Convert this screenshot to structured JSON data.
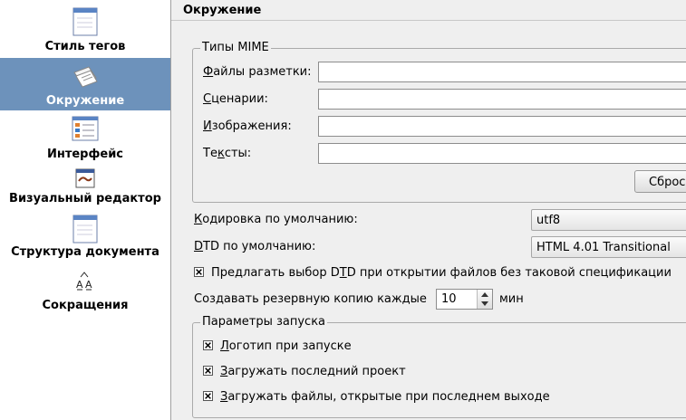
{
  "sidebar": {
    "items": [
      {
        "label": "Стиль тегов",
        "icon": "tag-style-icon"
      },
      {
        "label": "Окружение",
        "icon": "environment-icon",
        "selected": true
      },
      {
        "label": "Интерфейс",
        "icon": "interface-icon"
      },
      {
        "label": "Визуальный редактор",
        "icon": "visual-editor-icon"
      },
      {
        "label": "Структура документа",
        "icon": "document-structure-icon"
      },
      {
        "label": "Сокращения",
        "icon": "abbreviations-icon"
      }
    ]
  },
  "main": {
    "title": "Окружение",
    "mime": {
      "legend": "Типы MIME",
      "markup": {
        "pre": "",
        "hot": "Ф",
        "post": "айлы разметки:",
        "value": ""
      },
      "scripts": {
        "pre": "",
        "hot": "С",
        "post": "ценарии:",
        "value": ""
      },
      "images": {
        "pre": "",
        "hot": "И",
        "post": "зображения:",
        "value": ""
      },
      "texts": {
        "pre": "Те",
        "hot": "к",
        "post": "сты:",
        "value": ""
      },
      "reset_label": "Сброс"
    },
    "encoding": {
      "pre": "",
      "hot": "К",
      "post": "одировка по умолчанию:",
      "value": "utf8"
    },
    "dtd": {
      "pre": "",
      "hot": "D",
      "post": "TD по умолчанию:",
      "value": "HTML 4.01 Transitional"
    },
    "dtd_prompt": {
      "pre": "Предлагать выбор D",
      "hot": "T",
      "post": "D при открытии файлов без таковой спецификации",
      "checked": true
    },
    "backup": {
      "label": "Создавать резервную копию каждые",
      "value": "10",
      "unit": "мин"
    },
    "startup": {
      "legend": "Параметры запуска",
      "logo": {
        "pre": "",
        "hot": "Л",
        "post": "оготип при запуске",
        "checked": true
      },
      "last_project": {
        "pre": "",
        "hot": "З",
        "post": "агружать последний проект",
        "checked": true
      },
      "last_files": {
        "pre": "",
        "hot": "З",
        "post": "агружать файлы, открытые при последнем выходе",
        "checked": true
      }
    }
  },
  "colors": {
    "selection": "#6d92bb",
    "panel": "#efefef"
  }
}
